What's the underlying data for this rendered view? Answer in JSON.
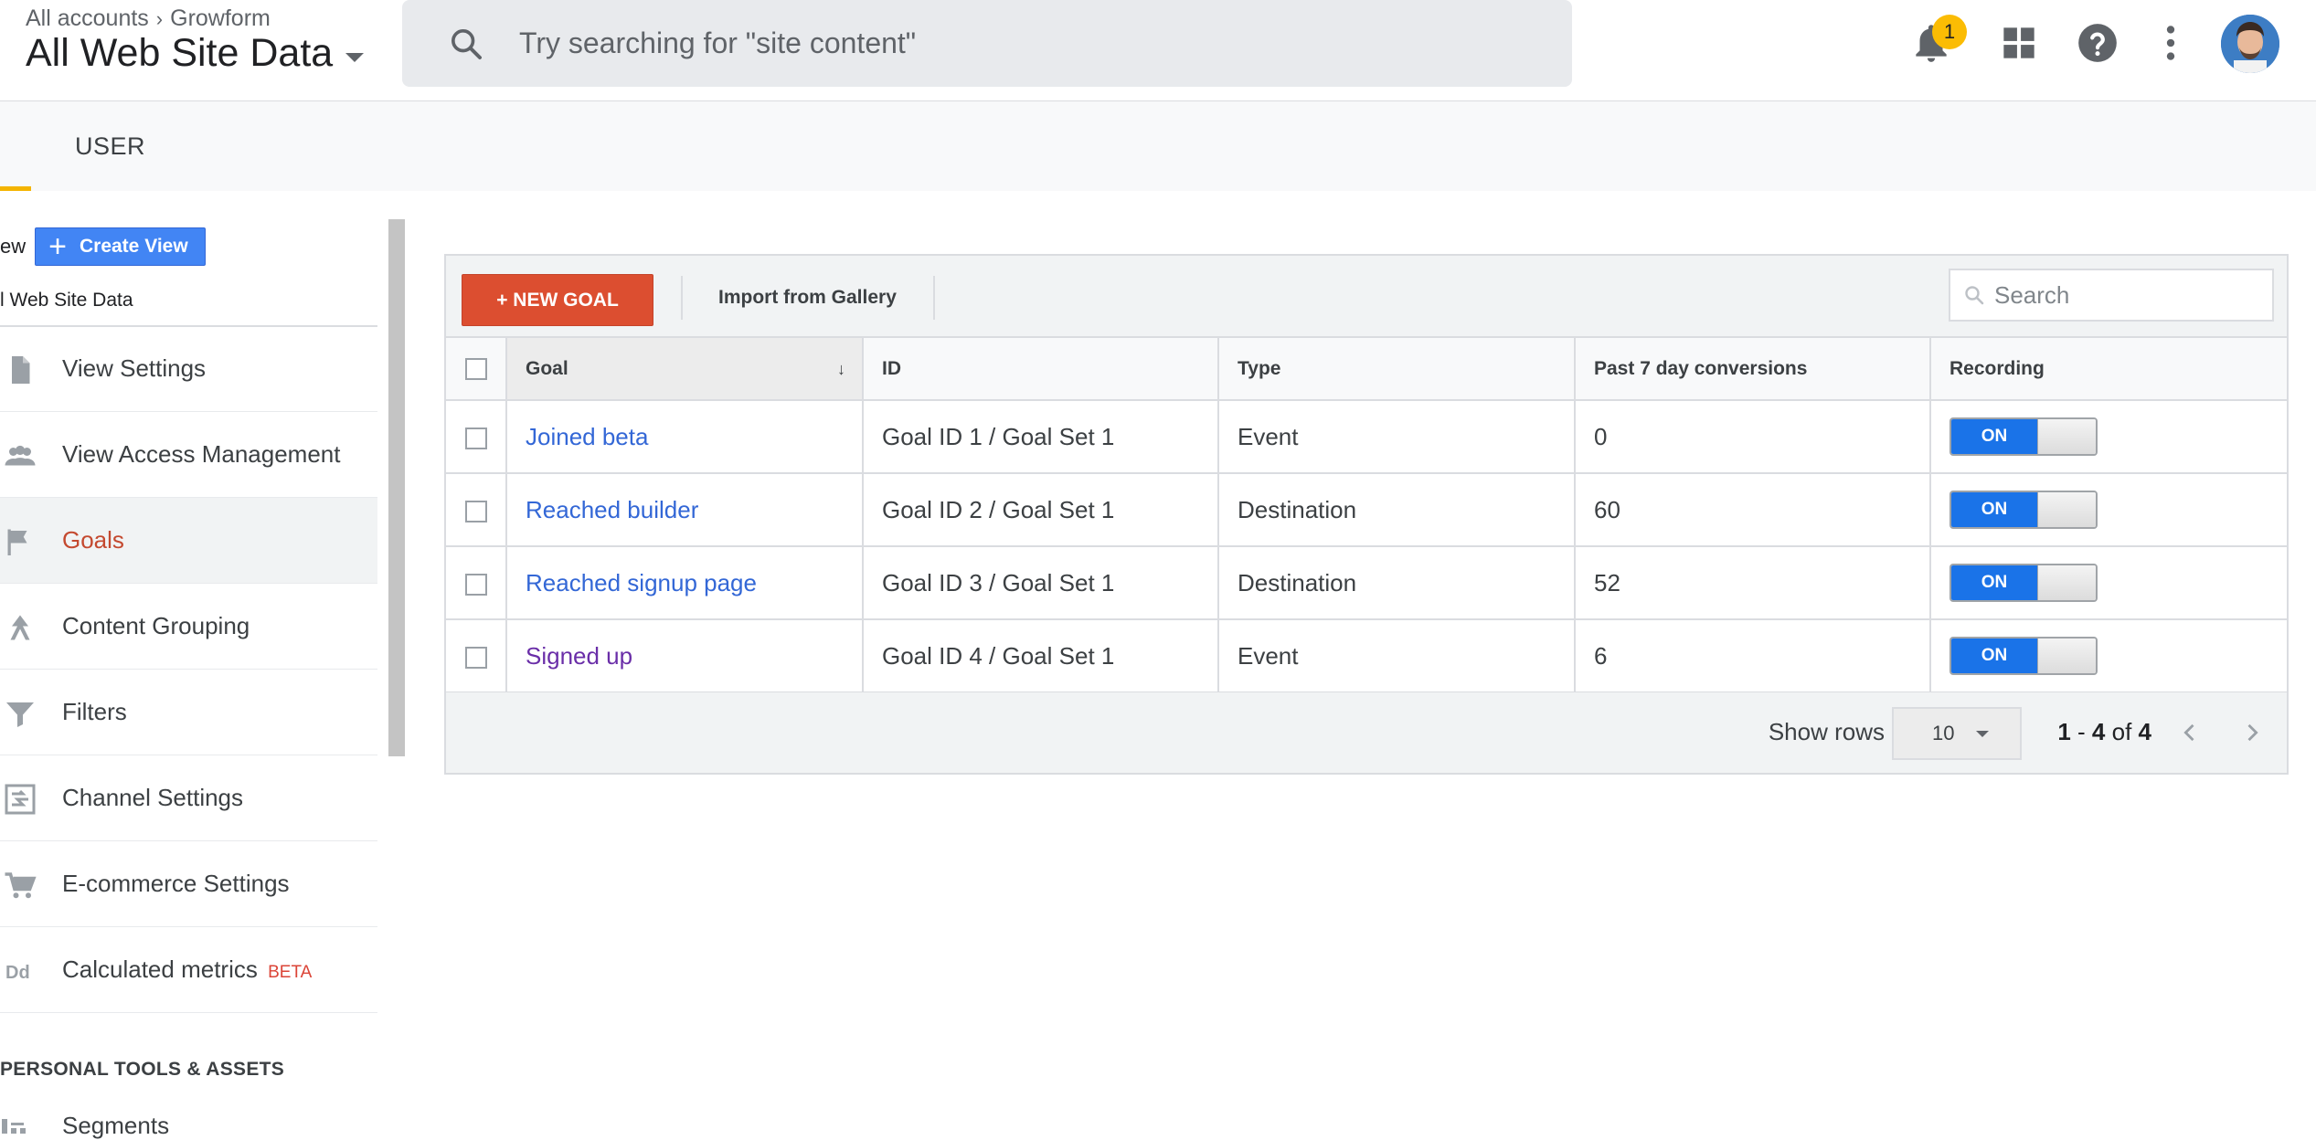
{
  "header": {
    "breadcrumb": [
      "All accounts",
      "Growform"
    ],
    "breadcrumb_sep": "›",
    "view_title": "All Web Site Data",
    "search_placeholder": "Try searching for \"site content\"",
    "notification_count": "1",
    "icons": [
      "bell-icon",
      "apps-grid-icon",
      "help-icon",
      "more-vert-icon",
      "avatar"
    ]
  },
  "subbar": {
    "tab": "USER",
    "accent_color": "#f4b400"
  },
  "left": {
    "view_label": "ew",
    "create_view": "Create View",
    "view_name": "l Web Site Data",
    "nav": [
      {
        "label": "View Settings",
        "icon": "document-icon",
        "active": false
      },
      {
        "label": "View Access Management",
        "icon": "people-icon",
        "active": false
      },
      {
        "label": "Goals",
        "icon": "flag-icon",
        "active": true
      },
      {
        "label": "Content Grouping",
        "icon": "grouping-icon",
        "active": false
      },
      {
        "label": "Filters",
        "icon": "filter-icon",
        "active": false
      },
      {
        "label": "Channel Settings",
        "icon": "channel-icon",
        "active": false
      },
      {
        "label": "E-commerce Settings",
        "icon": "cart-icon",
        "active": false
      },
      {
        "label": "Calculated metrics",
        "icon": "dd-icon",
        "active": false,
        "badge": "BETA"
      }
    ],
    "section_heading": "PERSONAL TOOLS & ASSETS",
    "peek_item": "Segments"
  },
  "goals": {
    "new_goal": "+ NEW GOAL",
    "import": "Import from Gallery",
    "search_placeholder": "Search",
    "columns": [
      "Goal",
      "ID",
      "Type",
      "Past 7 day conversions",
      "Recording"
    ],
    "rows": [
      {
        "goal": "Joined beta",
        "id": "Goal ID 1 / Goal Set 1",
        "type": "Event",
        "conversions": "0",
        "recording": "ON"
      },
      {
        "goal": "Reached builder",
        "id": "Goal ID 2 / Goal Set 1",
        "type": "Destination",
        "conversions": "60",
        "recording": "ON"
      },
      {
        "goal": "Reached signup page",
        "id": "Goal ID 3 / Goal Set 1",
        "type": "Destination",
        "conversions": "52",
        "recording": "ON"
      },
      {
        "goal": "Signed up",
        "id": "Goal ID 4 / Goal Set 1",
        "type": "Event",
        "conversions": "6",
        "recording": "ON"
      }
    ],
    "footer": {
      "show_rows": "Show rows",
      "rows_value": "10",
      "range_start": "1",
      "range_end": "4",
      "range_of": "of",
      "range_total": "4"
    }
  },
  "colors": {
    "primary_button": "#dc4e30",
    "create_view_button": "#4285f4",
    "toggle_on": "#1a73e8",
    "link": "#3367d6",
    "active_nav": "#c4492f"
  }
}
